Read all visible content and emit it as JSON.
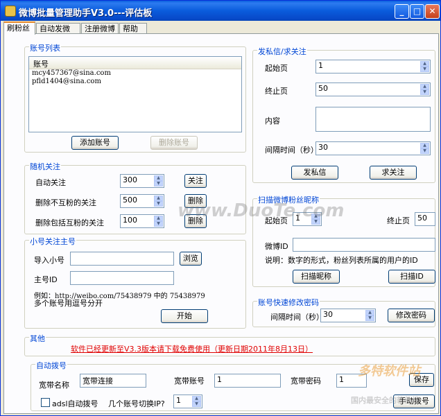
{
  "window": {
    "title": "微博批量管理助手V3.0---评估板",
    "min": "_",
    "max": "□",
    "close": "✕"
  },
  "tabs": [
    "刷粉丝",
    "自动发微博",
    "注册微博",
    "帮助"
  ],
  "account_list": {
    "title": "账号列表",
    "column": "账号",
    "accounts": [
      "mcy457367@sina.com",
      "pfld1404@sina.com"
    ],
    "add_button": "添加账号",
    "delete_button": "删除账号"
  },
  "random_follow": {
    "title": "随机关注",
    "rows": [
      {
        "label": "自动关注",
        "value": "300",
        "button": "关注"
      },
      {
        "label": "删除不互粉的关注",
        "value": "500",
        "button": "删除"
      },
      {
        "label": "删除包括互粉的关注",
        "value": "100",
        "button": "删除"
      }
    ]
  },
  "follow_main": {
    "title": "小号关注主号",
    "import_label": "导入小号",
    "browse_button": "浏览",
    "main_id_label": "主号ID",
    "example_line1": "例如：http://weibo.com/75438979 中的 75438979",
    "example_line2": "多个账号用逗号分开",
    "start_button": "开始"
  },
  "private_msg": {
    "title": "发私信/求关注",
    "start_label": "起始页",
    "start_value": "1",
    "end_label": "终止页",
    "end_value": "50",
    "content_label": "内容",
    "interval_label": "间隔时间（秒）",
    "interval_value": "30",
    "send_button": "发私信",
    "follow_button": "求关注"
  },
  "scan": {
    "title": "扫描微博粉丝昵称",
    "start_label": "起始页",
    "start_value": "1",
    "end_label": "终止页",
    "end_value": "50",
    "weibo_id_label": "微博ID",
    "desc": "说明：数字的形式，粉丝列表所属的用户的ID",
    "scan_nick_button": "扫描昵称",
    "scan_id_button": "扫描ID"
  },
  "password": {
    "title": "账号快速修改密码",
    "interval_label": "间隔时间（秒）",
    "interval_value": "30",
    "button": "修改密码"
  },
  "other": {
    "title": "其他",
    "notice": "软件已经更新至V3.3版本请下载免费使用（更新日期2011年8月13日）"
  },
  "dial": {
    "title": "自动拨号",
    "bb_name_label": "宽带名称",
    "bb_name_value": "宽带连接",
    "bb_account_label": "宽带账号",
    "bb_account_value": "1",
    "bb_password_label": "宽带密码",
    "bb_password_value": "1",
    "save_button": "保存",
    "adsl_label": "adsl自动拨号",
    "switch_label": "几个账号切换IP?",
    "switch_value": "1",
    "manual_button": "手动拨号"
  },
  "watermarks": [
    "www.DuoTe.com",
    "多特软件站",
    "国内最安全的软件站"
  ]
}
